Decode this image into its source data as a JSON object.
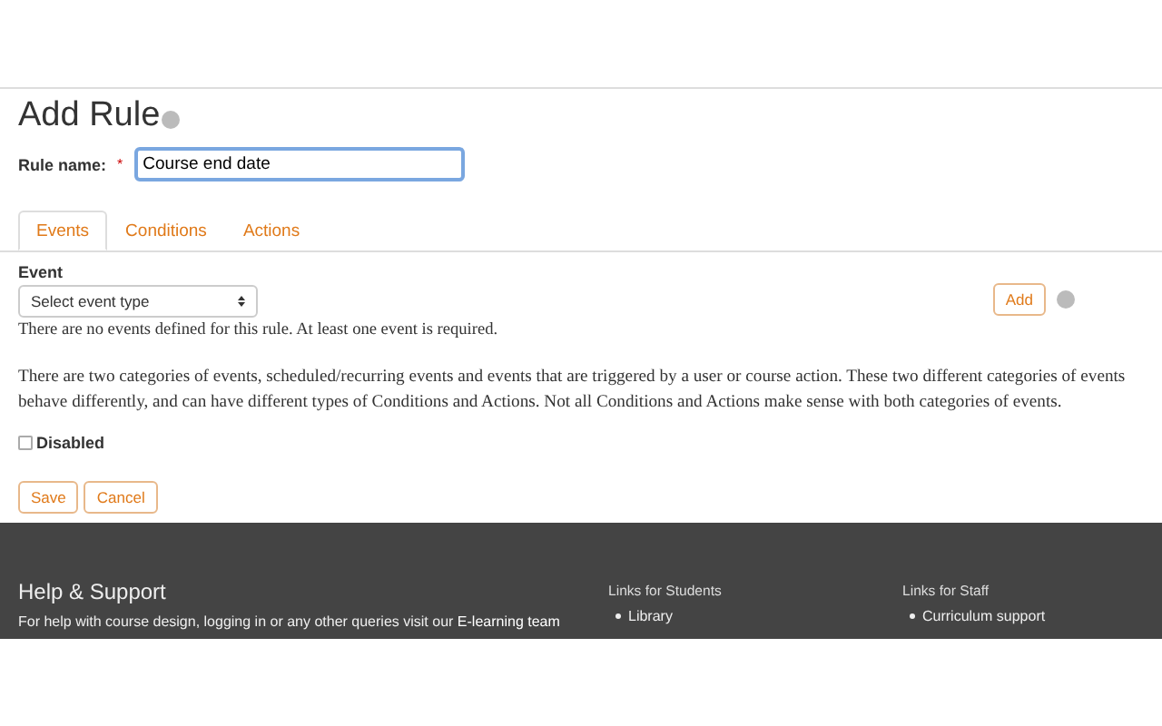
{
  "page": {
    "title": "Add Rule"
  },
  "rule_name": {
    "label": "Rule name:",
    "required_mark": "*",
    "value": "Course end date"
  },
  "tabs": [
    {
      "label": "Events",
      "selected": true
    },
    {
      "label": "Conditions",
      "selected": false
    },
    {
      "label": "Actions",
      "selected": false
    }
  ],
  "event": {
    "label": "Event",
    "select_value": "Select event type",
    "add_button": "Add",
    "notice": "There are no events defined for this rule. At least one event is required."
  },
  "description": "There are two categories of events, scheduled/recurring events and events that are triggered by a user or course action. These two different categories of events behave differently, and can have different types of Conditions and Actions. Not all Conditions and Actions make sense with both categories of events.",
  "disabled": {
    "label": "Disabled",
    "checked": false
  },
  "buttons": [
    "Save",
    "Cancel"
  ],
  "footer": {
    "title": "Help & Support",
    "text": "For help with course design, logging in or any other queries visit our",
    "link": "E-learning team",
    "columns": [
      {
        "heading": "Links for Students",
        "items": [
          "Library"
        ]
      },
      {
        "heading": "Links for Staff",
        "items": [
          "Curriculum support"
        ]
      }
    ]
  }
}
